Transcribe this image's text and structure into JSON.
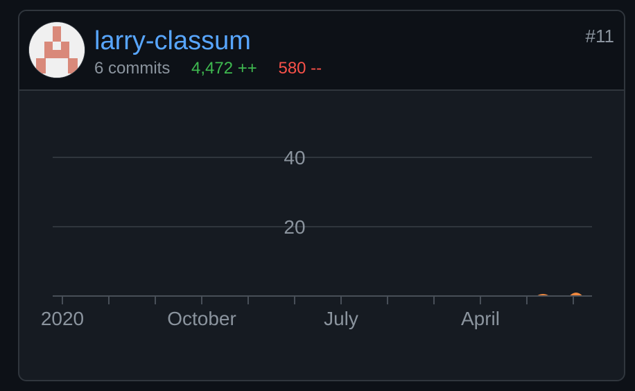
{
  "contributor": {
    "username": "larry-classum",
    "commits": "6 commits",
    "additions": "4,472 ++",
    "deletions": "580 --",
    "rank": "#11",
    "avatar": "identicon-avatar"
  },
  "colors": {
    "link": "#58a6ff",
    "additions": "#3fb950",
    "deletions": "#f85149",
    "area": "#f0883e",
    "identicon": "#d9897a"
  },
  "chart_data": {
    "type": "area",
    "ylim": [
      0,
      40
    ],
    "y_ticks": [
      {
        "value": 20,
        "label": "20"
      },
      {
        "value": 40,
        "label": "40"
      }
    ],
    "x_ticks": [
      "2020",
      "October",
      "July",
      "April"
    ],
    "grid": true,
    "series": [
      {
        "values": [
          {
            "x": "2021-05-17",
            "y": 0
          },
          {
            "x": "2021-05-24",
            "y": 1.5
          },
          {
            "x": "2021-05-31",
            "y": 0
          },
          {
            "x": "2021-06-21",
            "y": 0
          },
          {
            "x": "2021-06-28",
            "y": 2.5
          },
          {
            "x": "2021-07-05",
            "y": 0
          }
        ]
      }
    ]
  }
}
